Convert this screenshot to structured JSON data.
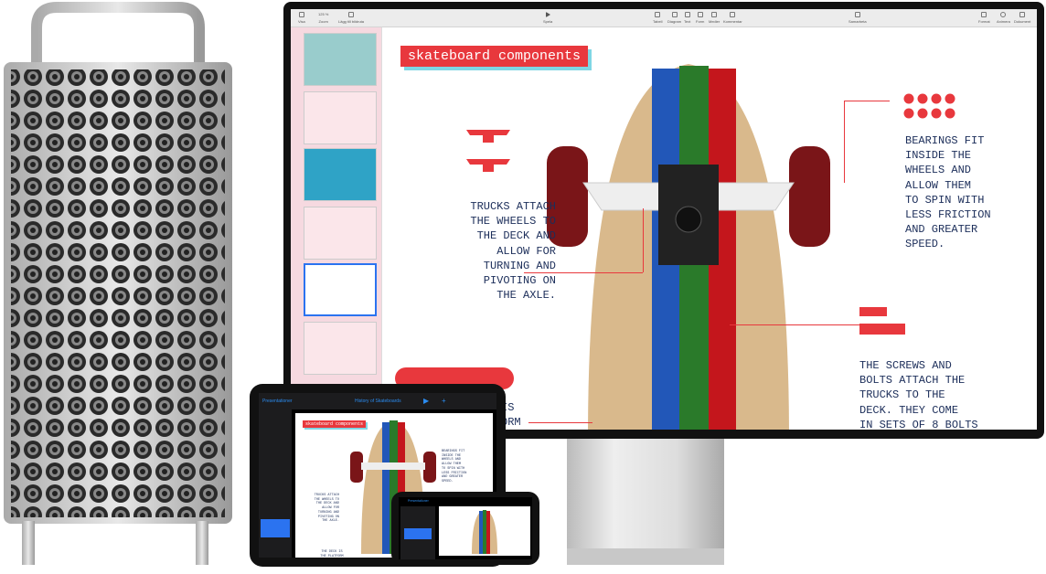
{
  "toolbar": {
    "items": [
      "Visa",
      "Zoom",
      "Lägg till bildruta",
      "Spela",
      "Tabell",
      "Diagram",
      "Text",
      "Form",
      "Medier",
      "Kommentar",
      "Samarbeta",
      "Format",
      "Animera",
      "Dokument"
    ],
    "zoom_value": "125 %"
  },
  "slide": {
    "title": "skateboard components",
    "trucks_text": "TRUCKS ATTACH\nTHE WHEELS TO\nTHE DECK AND\nALLOW FOR\nTURNING AND\nPIVOTING ON\nTHE AXLE.",
    "bearings_text": "BEARINGS FIT\nINSIDE THE\nWHEELS AND\nALLOW THEM\nTO SPIN WITH\nLESS FRICTION\nAND GREATER\nSPEED.",
    "screws_text": "THE SCREWS AND\nBOLTS ATTACH THE\nTRUCKS TO THE\nDECK. THEY COME\nIN SETS OF 8 BOLTS",
    "deck_text_partial": "IS\nORM",
    "deck_text": "THE DECK IS\nTHE PLATFORM\nYOU STAND ON."
  },
  "ipad": {
    "back_label": "Presentationer",
    "doc_title": "History of Skateboards"
  },
  "iphone": {
    "back_label": "Presentationer"
  },
  "colors": {
    "accent": "#e8383d",
    "text": "#1c2e5a",
    "selection": "#2b73f0",
    "stripe_blue": "#2257b8",
    "stripe_green": "#2a7a2a",
    "stripe_red": "#c4161c",
    "deck": "#d9b98c"
  }
}
